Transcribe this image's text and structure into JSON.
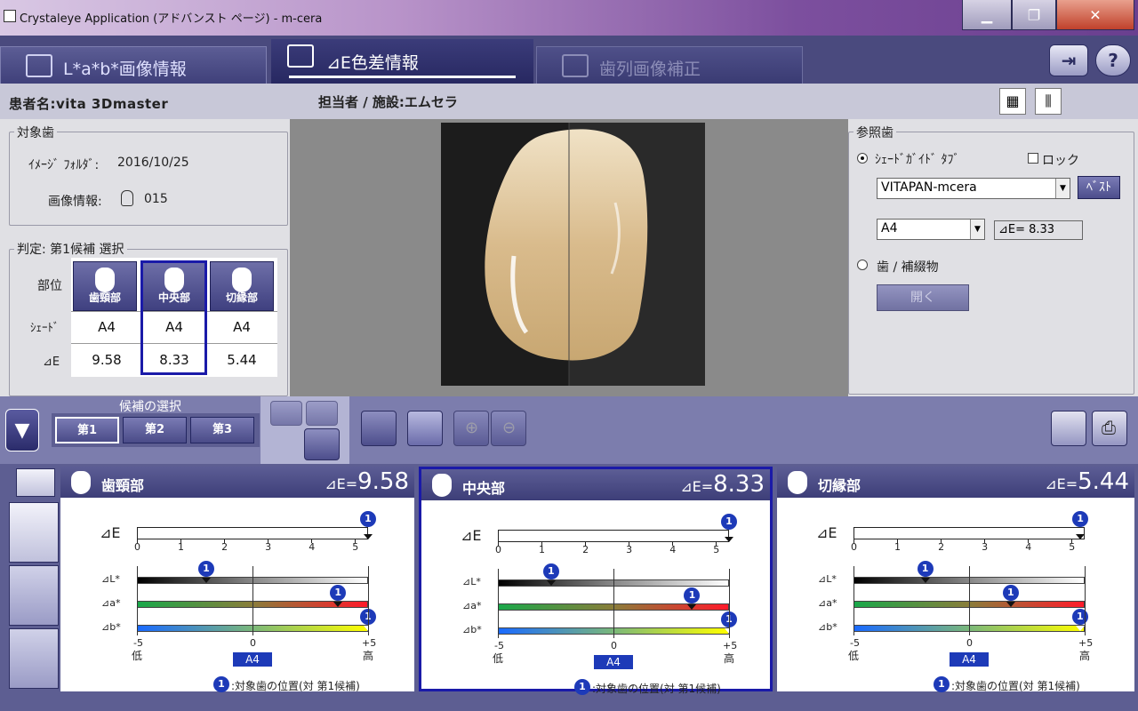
{
  "window": {
    "title": "Crystaleye Application (アドバンスト ページ) - m-cera"
  },
  "tabs": {
    "lab": "L*a*b*画像情報",
    "de": "⊿E色差情報",
    "align": "歯列画像補正"
  },
  "header": {
    "patient": "患者名:vita 3Dmaster",
    "staff": "担当者 / 施設:エムセラ"
  },
  "target": {
    "group_label": "対象歯",
    "folder_label": "ｲﾒｰｼﾞ ﾌｫﾙﾀﾞ:",
    "folder_value": "2016/10/25",
    "info_label": "画像情報:",
    "info_value": "015"
  },
  "judgement": {
    "group_label": "判定: 第1候補 選択",
    "row_part": "部位",
    "row_shade": "ｼｪｰﾄﾞ",
    "row_de": "⊿E",
    "parts": [
      {
        "name": "歯頸部",
        "shade": "A4",
        "de": "9.58"
      },
      {
        "name": "中央部",
        "shade": "A4",
        "de": "8.33"
      },
      {
        "name": "切縁部",
        "shade": "A4",
        "de": "5.44"
      }
    ],
    "selected_index": 1
  },
  "reference": {
    "group_label": "参照歯",
    "radio_shade": "ｼｪｰﾄﾞｶﾞｲﾄﾞ ﾀﾌﾞ",
    "lock_label": "ロック",
    "guide_value": "VITAPAN-mcera",
    "best_button": "ﾍﾞｽﾄ",
    "shade_value": "A4",
    "de_readout": "⊿E= 8.33",
    "radio_tooth": "歯 / 補綴物",
    "open_button": "開く"
  },
  "candidates": {
    "label": "候補の選択",
    "items": [
      "第1",
      "第2",
      "第3"
    ],
    "selected_index": 0
  },
  "panels": [
    {
      "name": "歯頸部",
      "de_label": "⊿E=",
      "de_value": "9.58",
      "de_pos": 5.3,
      "L": -2.0,
      "a": 3.7,
      "b": 5.0
    },
    {
      "name": "中央部",
      "de_label": "⊿E=",
      "de_value": "8.33",
      "de_pos": 5.3,
      "L": -2.7,
      "a": 3.4,
      "b": 5.0
    },
    {
      "name": "切縁部",
      "de_label": "⊿E=",
      "de_value": "5.44",
      "de_pos": 5.2,
      "L": -1.9,
      "a": 1.8,
      "b": 4.8
    }
  ],
  "chart_common": {
    "de_axis_label": "⊿E",
    "de_ticks": [
      "0",
      "1",
      "2",
      "3",
      "4",
      "5"
    ],
    "L_label": "⊿L*",
    "a_label": "⊿a*",
    "b_label": "⊿b*",
    "min_label": "-5",
    "zero_label": "0",
    "max_label": "+5",
    "low_label": "低",
    "high_label": "高",
    "ref_shade": "A4",
    "marker_number": "1",
    "legend_text": ":対象歯の位置(対 第1候補)"
  },
  "colors": {
    "accent": "#1d3ab8",
    "selected_border": "#1a1aa8"
  }
}
